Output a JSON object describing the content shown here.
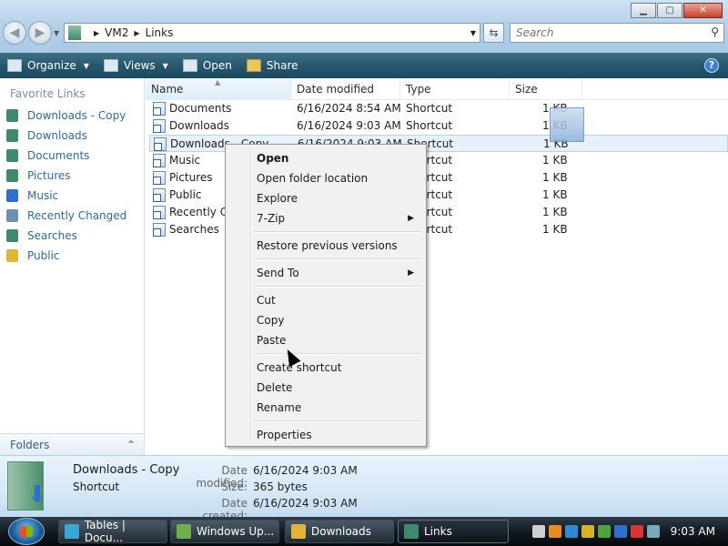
{
  "window": {
    "controls": {
      "minimize": "▁",
      "maximize": "▢",
      "close": "✕"
    },
    "address": {
      "segments": [
        "VM2",
        "Links"
      ]
    },
    "search": {
      "placeholder": "Search"
    }
  },
  "toolbar": {
    "organize": "Organize",
    "views": "Views",
    "open": "Open",
    "share": "Share"
  },
  "nav_pane": {
    "favorites_title": "Favorite Links",
    "favorites": [
      {
        "label": "Downloads - Copy",
        "icon": "shortcut-icon",
        "color": "#3f8a6b"
      },
      {
        "label": "Downloads",
        "icon": "downloads-icon",
        "color": "#3f8a6b"
      },
      {
        "label": "Documents",
        "icon": "documents-icon",
        "color": "#3f8a6b"
      },
      {
        "label": "Pictures",
        "icon": "pictures-icon",
        "color": "#3f8a6b"
      },
      {
        "label": "Music",
        "icon": "music-icon",
        "color": "#2f6fd0"
      },
      {
        "label": "Recently Changed",
        "icon": "recent-icon",
        "color": "#6b8fb7"
      },
      {
        "label": "Searches",
        "icon": "searches-icon",
        "color": "#3f8a6b"
      },
      {
        "label": "Public",
        "icon": "public-folder-icon",
        "color": "#e2b632"
      }
    ],
    "folders_label": "Folders"
  },
  "file_list": {
    "columns": [
      "Name",
      "Date modified",
      "Type",
      "Size"
    ],
    "rows": [
      {
        "name": "Documents",
        "date": "6/16/2024 8:54 AM",
        "type": "Shortcut",
        "size": "1 KB"
      },
      {
        "name": "Downloads",
        "date": "6/16/2024 9:03 AM",
        "type": "Shortcut",
        "size": "1 KB"
      },
      {
        "name": "Downloads - Copy",
        "date": "6/16/2024 9:03 AM",
        "type": "Shortcut",
        "size": "1 KB"
      },
      {
        "name": "Music",
        "date": "",
        "type": "Shortcut",
        "size": "1 KB"
      },
      {
        "name": "Pictures",
        "date": "",
        "type": "Shortcut",
        "size": "1 KB"
      },
      {
        "name": "Public",
        "date": "",
        "type": "Shortcut",
        "size": "1 KB"
      },
      {
        "name": "Recently Changed",
        "date": "",
        "type": "Shortcut",
        "size": "1 KB"
      },
      {
        "name": "Searches",
        "date": "",
        "type": "Shortcut",
        "size": "1 KB"
      }
    ],
    "selected_row": 2
  },
  "context_menu": {
    "items": [
      {
        "label": "Open",
        "bold": true
      },
      {
        "label": "Open folder location"
      },
      {
        "label": "Explore"
      },
      {
        "label": "7-Zip",
        "submenu": true
      },
      {
        "separator": true
      },
      {
        "label": "Restore previous versions"
      },
      {
        "separator": true
      },
      {
        "label": "Send To",
        "submenu": true
      },
      {
        "separator": true
      },
      {
        "label": "Cut"
      },
      {
        "label": "Copy"
      },
      {
        "label": "Paste"
      },
      {
        "separator": true
      },
      {
        "label": "Create shortcut"
      },
      {
        "label": "Delete"
      },
      {
        "label": "Rename"
      },
      {
        "separator": true
      },
      {
        "label": "Properties"
      }
    ]
  },
  "details_pane": {
    "name": "Downloads - Copy",
    "type": "Shortcut",
    "date_modified_label": "Date modified:",
    "date_modified": "6/16/2024 9:03 AM",
    "size_label": "Size:",
    "size": "365 bytes",
    "date_created_label": "Date created:",
    "date_created": "6/16/2024 9:03 AM"
  },
  "taskbar": {
    "buttons": [
      {
        "label": "Tables | Docu...",
        "icon": "edge-icon",
        "color": "#3aa5d8"
      },
      {
        "label": "Windows Up...",
        "icon": "windows-update-icon",
        "color": "#6fae4c"
      },
      {
        "label": "Downloads",
        "icon": "explorer-folder-icon",
        "color": "#e2b632"
      },
      {
        "label": "Links",
        "icon": "explorer-folder-icon",
        "color": "#3f8a6b",
        "active": true
      }
    ],
    "tray_icons": [
      {
        "name": "keyboard-icon",
        "color": "#cfcfcf"
      },
      {
        "name": "search-tray-icon",
        "color": "#f08a1d"
      },
      {
        "name": "network-icon",
        "color": "#2f8bd5"
      },
      {
        "name": "security-icon",
        "color": "#d9b21f"
      },
      {
        "name": "update-icon",
        "color": "#4aa53c"
      },
      {
        "name": "display-icon",
        "color": "#2f6fd0"
      },
      {
        "name": "volume-muted-icon",
        "color": "#d33"
      },
      {
        "name": "power-icon",
        "color": "#7ab"
      }
    ],
    "clock": "9:03 AM"
  }
}
